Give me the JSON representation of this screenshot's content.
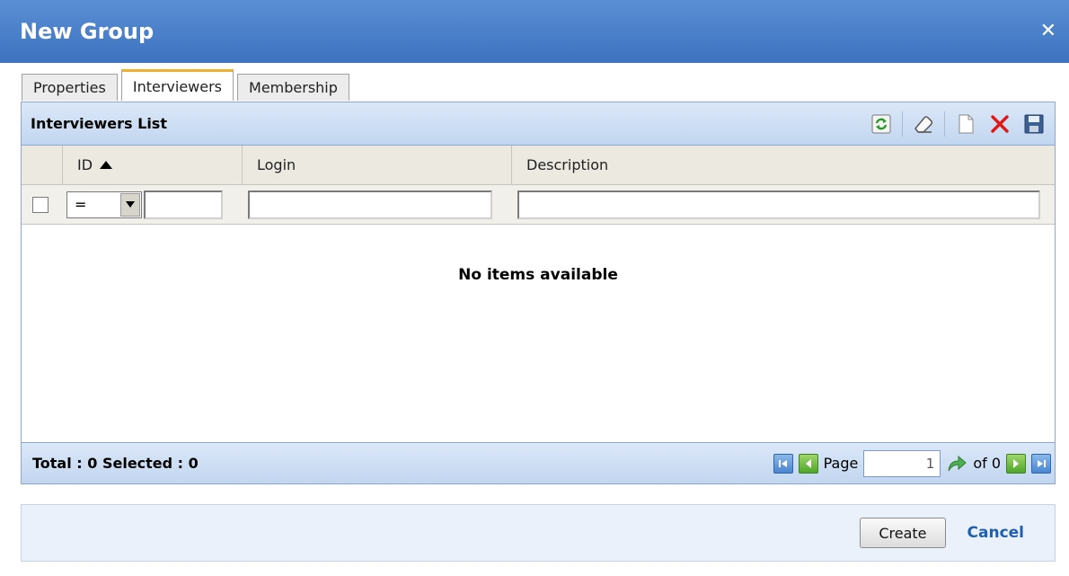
{
  "dialog": {
    "title": "New Group",
    "close_glyph": "✕"
  },
  "tabs": [
    {
      "label": "Properties",
      "active": false
    },
    {
      "label": "Interviewers",
      "active": true
    },
    {
      "label": "Membership",
      "active": false
    }
  ],
  "list": {
    "title": "Interviewers List",
    "toolbar": [
      "refresh-icon",
      "eraser-icon",
      "new-document-icon",
      "delete-icon",
      "save-icon"
    ],
    "columns": [
      {
        "label": "ID",
        "sorted": "asc"
      },
      {
        "label": "Login"
      },
      {
        "label": "Description"
      }
    ],
    "filter": {
      "operator": "=",
      "id_value": "",
      "login_value": "",
      "description_value": ""
    },
    "empty_message": "No items available"
  },
  "footer": {
    "totals": "Total : 0 Selected : 0",
    "page_label": "Page",
    "page_value": "1",
    "of_label": "of 0"
  },
  "actions": {
    "create_label": "Create",
    "cancel_label": "Cancel"
  },
  "colors": {
    "title_bar": "#4a80c8",
    "tab_active_accent": "#f0b030",
    "link": "#1f5fb0"
  }
}
